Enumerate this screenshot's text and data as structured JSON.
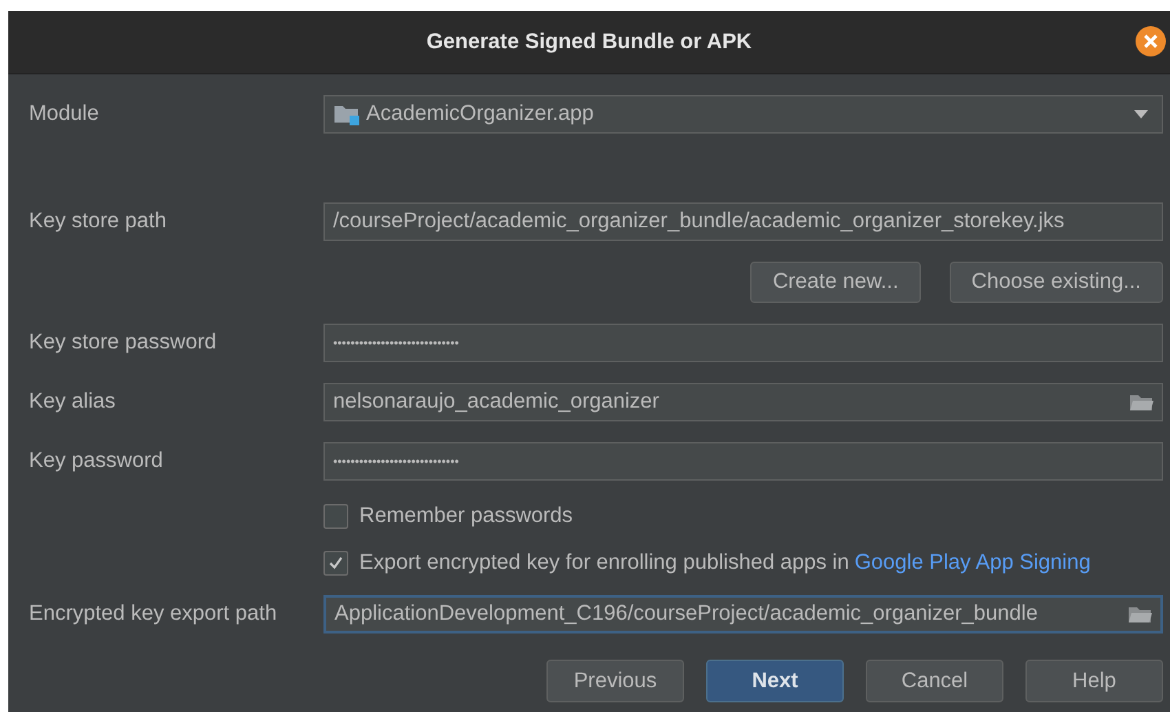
{
  "window": {
    "title": "Generate Signed Bundle or APK"
  },
  "module": {
    "label": "Module",
    "value": "AcademicOrganizer.app"
  },
  "key_store_path": {
    "label": "Key store path",
    "value": "/courseProject/academic_organizer_bundle/academic_organizer_storekey.jks"
  },
  "key_store_buttons": [
    "Create new...",
    "Choose existing..."
  ],
  "key_store_password": {
    "label": "Key store password",
    "value": "•••••••••••••••••••••••••••••"
  },
  "key_alias": {
    "label": "Key alias",
    "value": "nelsonaraujo_academic_organizer"
  },
  "key_password": {
    "label": "Key password",
    "value": "•••••••••••••••••••••••••••••"
  },
  "remember_passwords": {
    "label": "Remember passwords",
    "checked": false
  },
  "export_encrypted_key": {
    "label": "Export encrypted key for enrolling published apps in",
    "link": "Google Play App Signing",
    "checked": true
  },
  "encrypted_key_export_path": {
    "label": "Encrypted key export path",
    "value": "ApplicationDevelopment_C196/courseProject/academic_organizer_bundle"
  },
  "buttons": [
    {
      "label": "Previous",
      "primary": false
    },
    {
      "label": "Next",
      "primary": true
    },
    {
      "label": "Cancel",
      "primary": false
    },
    {
      "label": "Help",
      "primary": false
    }
  ]
}
